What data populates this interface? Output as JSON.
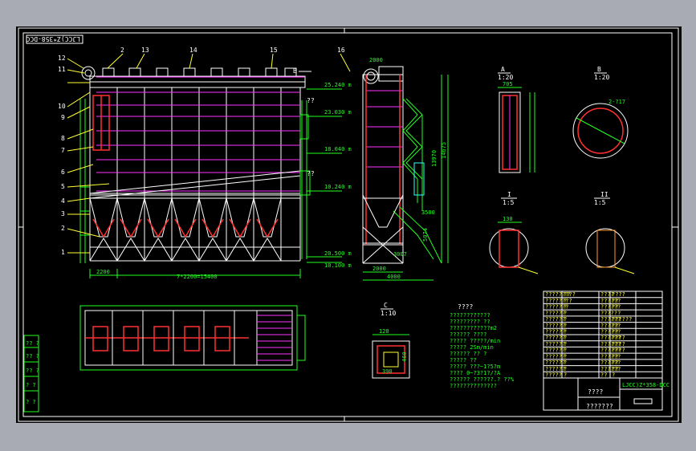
{
  "drawing": {
    "code_label": "LJCC)Z*358-DCC",
    "part_numbers": [
      "1",
      "2",
      "3",
      "4",
      "5",
      "6",
      "7",
      "8",
      "9",
      "10",
      "11",
      "12",
      "2",
      "13",
      "14",
      "15",
      "16"
    ],
    "view_labels": {
      "A": {
        "name": "A",
        "scale": "1:20"
      },
      "B": {
        "name": "B",
        "scale": "1:20"
      },
      "C": {
        "name": "C",
        "scale": "1:10"
      },
      "I": {
        "name": "I",
        "scale": "1:5"
      },
      "II": {
        "name": "II",
        "scale": "1:5"
      }
    },
    "dimensions": {
      "bottom_left": "2200",
      "bottom_total": "7*2200=15400",
      "side_bottom_1": "2000",
      "side_bottom_2": "4000",
      "side_height": "13970",
      "side_height_2": "14675",
      "side_mid": "5074",
      "side_low": "3500",
      "side_small": "3007",
      "a_width": "705",
      "b_dia": "2-?17",
      "i_width": "130",
      "c_width": "120",
      "c_height": "460",
      "c_side": "390"
    },
    "elevations": [
      "25.240 m",
      "23.030 m",
      "18.040 m",
      "10.240 m",
      "20.500 m",
      "10.100 m"
    ],
    "arrows": [
      "B",
      "??",
      "??"
    ],
    "notes_title": "????",
    "notes_lines": [
      "????????????",
      "????????? ??",
      "????????????m2",
      "??????  ????",
      "?????  ?????/min",
      "?????  2Sm/min",
      "??????  ?? ?",
      "?????  ??",
      "?????  ???~1?5?m",
      "????  0~?3?1?/?A",
      "??????  ??????.?  ??%",
      "??????????????"
    ],
    "title_block": {
      "project_code": "LJCC)Z*358-DCC",
      "drawing_name": "????",
      "company": "???????",
      "rows": [
        [
          "?????????",
          "??",
          "????",
          "????"
        ],
        [
          "????????",
          "?",
          "??????",
          "??"
        ],
        [
          "???????",
          "?",
          "??????",
          "??"
        ],
        [
          "??????",
          "?",
          "??????",
          ""
        ],
        [
          "??????",
          "?",
          "??????",
          "??????"
        ],
        [
          "??????",
          "?",
          "??????",
          "??"
        ],
        [
          "??????",
          "?",
          "??????",
          "??"
        ],
        [
          "??????",
          "?",
          "??????",
          "????"
        ],
        [
          "??????",
          "?",
          "??????",
          "????"
        ],
        [
          "??????",
          "?",
          "??????",
          "????"
        ],
        [
          "??????",
          "?",
          "??????",
          "??"
        ],
        [
          "??????",
          "?",
          "??????",
          "??"
        ],
        [
          "??????",
          "?",
          "??????",
          "??"
        ],
        [
          "?????",
          "?",
          "??",
          "?"
        ]
      ]
    },
    "side_stamp": [
      "?? ?",
      "?? ?",
      "?? ?",
      "? ?",
      "? ?"
    ]
  },
  "colors": {
    "background": "#000000",
    "frame": "#ffffff",
    "steel": "#ffffff",
    "bags": "#ff33ff",
    "hoppers": "#ff3030",
    "dimension": "#22ff22",
    "callout": "#ffff33"
  }
}
